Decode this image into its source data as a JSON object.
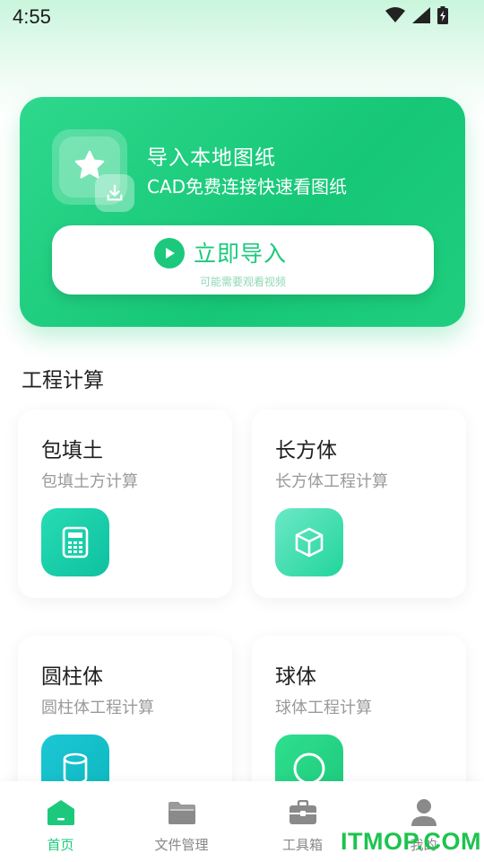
{
  "status_bar": {
    "time": "4:55"
  },
  "banner": {
    "title": "导入本地图纸",
    "subtitle": "CAD免费连接快速看图纸",
    "import_button_label": "立即导入",
    "import_button_hint": "可能需要观看视频",
    "icons": [
      "star-icon",
      "download-icon",
      "play-icon"
    ]
  },
  "section": {
    "title": "工程计算"
  },
  "cards": [
    {
      "title": "包填土",
      "subtitle": "包填土方计算",
      "icon": "calculator-icon",
      "color": "#19c9a6"
    },
    {
      "title": "长方体",
      "subtitle": "长方体工程计算",
      "icon": "cube-icon",
      "color": "#2fd8a7"
    },
    {
      "title": "圆柱体",
      "subtitle": "圆柱体工程计算",
      "icon": "cylinder-icon",
      "color": "#14c2c8"
    },
    {
      "title": "球体",
      "subtitle": "球体工程计算",
      "icon": "sphere-icon",
      "color": "#2fd48a"
    }
  ],
  "bottom_nav": [
    {
      "label": "首页",
      "icon": "home-icon",
      "active": true
    },
    {
      "label": "文件管理",
      "icon": "folder-icon",
      "active": false
    },
    {
      "label": "工具箱",
      "icon": "toolbox-icon",
      "active": false
    },
    {
      "label": "我的",
      "icon": "user-icon",
      "active": false
    }
  ],
  "watermark": "ITMOP.COM",
  "colors": {
    "accent": "#1cc97c",
    "inactive": "#888888"
  }
}
